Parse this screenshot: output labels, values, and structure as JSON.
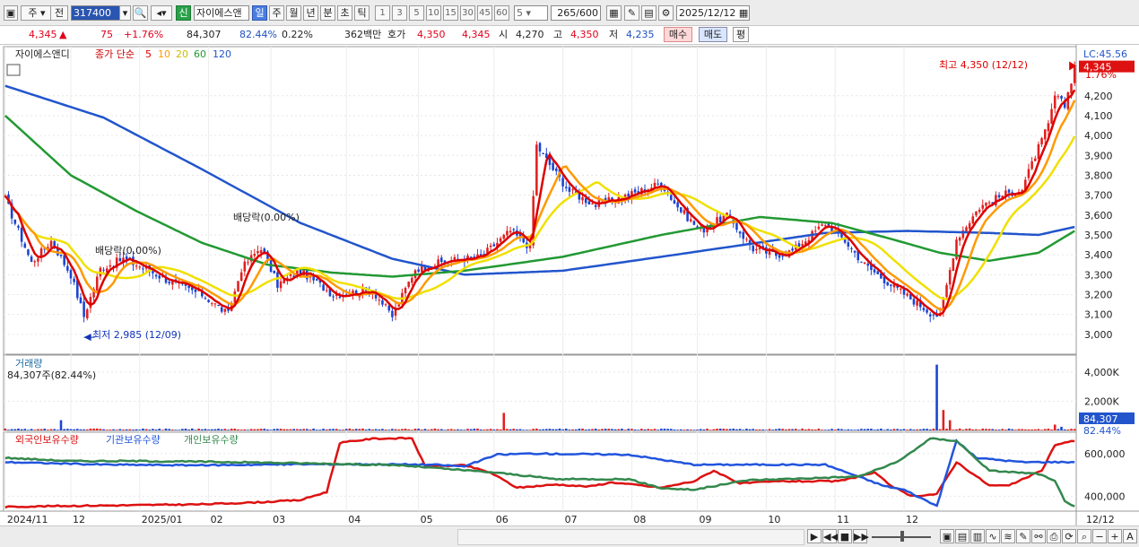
{
  "toolbar": {
    "period_week": "주",
    "prev_label": "전",
    "code": "317400",
    "new_badge": "신",
    "stock_name": "자이에스앤",
    "period_day": "일",
    "period_week2": "주",
    "period_month": "월",
    "period_year": "년",
    "period_minute": "분",
    "period_second": "초",
    "period_tick": "틱",
    "minute_options": [
      "1",
      "3",
      "5",
      "10",
      "15",
      "30",
      "45",
      "60"
    ],
    "minute_value": "5",
    "count_current": "265",
    "count_total": "/600",
    "date": "2025/12/12"
  },
  "quote": {
    "price": "4,345",
    "arrow": "▲",
    "change": "75",
    "change_pct": "+1.76%",
    "volume": "84,307",
    "volume_ratio": "82.44%",
    "turnover": "0.22%",
    "trade_value": "362백만",
    "ask_label": "호가",
    "ask_price": "4,350",
    "bid_price": "4,345",
    "open_label": "시",
    "open": "4,270",
    "high_label": "고",
    "high": "4,350",
    "low_label": "저",
    "low": "4,235",
    "buy_label": "매수",
    "sell_label": "매도",
    "eval_label": "평"
  },
  "chart_data": [
    {
      "type": "candlestick",
      "title": "자이에스앤디",
      "legend": [
        {
          "name": "종가 단순",
          "color": "#cc0000"
        },
        {
          "name": "5",
          "color": "#dd0000"
        },
        {
          "name": "10",
          "color": "#ff9900"
        },
        {
          "name": "20",
          "color": "#eedd00"
        },
        {
          "name": "60",
          "color": "#229933"
        },
        {
          "name": "120",
          "color": "#2255cc"
        }
      ],
      "ylim": [
        2900,
        4420
      ],
      "yticks": [
        "4,200",
        "4,100",
        "4,000",
        "3,900",
        "3,800",
        "3,700",
        "3,600",
        "3,500",
        "3,400",
        "3,300",
        "3,200",
        "3,100",
        "3,000"
      ],
      "ytick_values": [
        4200,
        4100,
        4000,
        3900,
        3800,
        3700,
        3600,
        3500,
        3400,
        3300,
        3200,
        3100,
        3000
      ],
      "x_labels": [
        "2024/11",
        "12",
        "2025/01",
        "02",
        "03",
        "04",
        "05",
        "06",
        "07",
        "08",
        "09",
        "10",
        "11",
        "12"
      ],
      "x_label_right": "12/12",
      "close_anchors": [
        [
          0,
          3680
        ],
        [
          8,
          3360
        ],
        [
          14,
          3470
        ],
        [
          20,
          3300
        ],
        [
          24,
          3090
        ],
        [
          29,
          3330
        ],
        [
          36,
          3380
        ],
        [
          44,
          3320
        ],
        [
          52,
          3250
        ],
        [
          60,
          3200
        ],
        [
          68,
          3100
        ],
        [
          72,
          3330
        ],
        [
          78,
          3440
        ],
        [
          83,
          3250
        ],
        [
          90,
          3320
        ],
        [
          100,
          3200
        ],
        [
          112,
          3220
        ],
        [
          118,
          3090
        ],
        [
          125,
          3330
        ],
        [
          135,
          3370
        ],
        [
          145,
          3390
        ],
        [
          154,
          3520
        ],
        [
          160,
          3440
        ],
        [
          162,
          3950
        ],
        [
          167,
          3830
        ],
        [
          172,
          3720
        ],
        [
          180,
          3650
        ],
        [
          190,
          3700
        ],
        [
          200,
          3760
        ],
        [
          205,
          3640
        ],
        [
          212,
          3520
        ],
        [
          220,
          3600
        ],
        [
          228,
          3430
        ],
        [
          235,
          3400
        ],
        [
          240,
          3420
        ],
        [
          250,
          3560
        ],
        [
          256,
          3470
        ],
        [
          262,
          3350
        ],
        [
          270,
          3250
        ],
        [
          276,
          3180
        ],
        [
          282,
          3110
        ],
        [
          285,
          3090
        ],
        [
          290,
          3480
        ],
        [
          297,
          3640
        ],
        [
          304,
          3700
        ],
        [
          310,
          3730
        ],
        [
          314,
          3900
        ],
        [
          318,
          4050
        ],
        [
          320,
          4200
        ],
        [
          323,
          4150
        ],
        [
          326,
          4345
        ]
      ],
      "ma_anchors": {
        "ma60": [
          [
            0,
            4100
          ],
          [
            20,
            3800
          ],
          [
            40,
            3620
          ],
          [
            60,
            3460
          ],
          [
            80,
            3350
          ],
          [
            100,
            3310
          ],
          [
            118,
            3290
          ],
          [
            140,
            3320
          ],
          [
            170,
            3390
          ],
          [
            200,
            3500
          ],
          [
            230,
            3590
          ],
          [
            252,
            3560
          ],
          [
            270,
            3480
          ],
          [
            285,
            3410
          ],
          [
            300,
            3370
          ],
          [
            315,
            3410
          ],
          [
            326,
            3520
          ]
        ],
        "ma120": [
          [
            0,
            4250
          ],
          [
            30,
            4090
          ],
          [
            60,
            3830
          ],
          [
            90,
            3560
          ],
          [
            118,
            3380
          ],
          [
            140,
            3300
          ],
          [
            170,
            3320
          ],
          [
            200,
            3390
          ],
          [
            225,
            3450
          ],
          [
            250,
            3510
          ],
          [
            275,
            3520
          ],
          [
            300,
            3510
          ],
          [
            315,
            3500
          ],
          [
            326,
            3540
          ]
        ]
      },
      "annotations": [
        {
          "text": "최고 4,350 (12/12)",
          "price": 4350
        },
        {
          "text": "최저 2,985 (12/09)",
          "price": 2985
        },
        {
          "text": "배당락(0.00%)",
          "price": 3590
        },
        {
          "text": "배당락(0.00%)",
          "price": 3430
        }
      ],
      "last_price_label": "4,345",
      "last_pct_label": "1.76%",
      "last_lc_label": "LC:45.56"
    },
    {
      "type": "bar",
      "title": "거래량",
      "value_label": "84,307주(82.44%)",
      "yticks": [
        "4,000K",
        "2,000K"
      ],
      "ytick_values": [
        4000,
        2000
      ],
      "ylim": [
        0,
        4600
      ],
      "last_label": "84,307",
      "ratio_label": "82.44%",
      "spikes": [
        [
          17,
          700
        ],
        [
          152,
          1200
        ],
        [
          284,
          4500
        ],
        [
          286,
          1400
        ],
        [
          288,
          700
        ],
        [
          320,
          400
        ],
        [
          322,
          250
        ]
      ]
    },
    {
      "type": "line",
      "title": "보유수량",
      "series": [
        {
          "name": "외국인보유수량",
          "color": "#dd1111",
          "anchors": [
            [
              0,
              350
            ],
            [
              20,
              355
            ],
            [
              40,
              358
            ],
            [
              60,
              362
            ],
            [
              78,
              372
            ],
            [
              90,
              382
            ],
            [
              98,
              420
            ],
            [
              102,
              650
            ],
            [
              112,
              670
            ],
            [
              124,
              672
            ],
            [
              128,
              540
            ],
            [
              140,
              545
            ],
            [
              148,
              510
            ],
            [
              156,
              440
            ],
            [
              168,
              455
            ],
            [
              178,
              445
            ],
            [
              185,
              465
            ],
            [
              200,
              440
            ],
            [
              210,
              470
            ],
            [
              216,
              520
            ],
            [
              224,
              460
            ],
            [
              236,
              470
            ],
            [
              254,
              470
            ],
            [
              265,
              510
            ],
            [
              270,
              450
            ],
            [
              276,
              400
            ],
            [
              284,
              410
            ],
            [
              290,
              560
            ],
            [
              300,
              450
            ],
            [
              306,
              450
            ],
            [
              316,
              520
            ],
            [
              320,
              640
            ],
            [
              326,
              660
            ]
          ]
        },
        {
          "name": "기관보유수량",
          "color": "#2255dd",
          "anchors": [
            [
              0,
              560
            ],
            [
              30,
              548
            ],
            [
              60,
              545
            ],
            [
              90,
              550
            ],
            [
              110,
              550
            ],
            [
              130,
              548
            ],
            [
              140,
              540
            ],
            [
              150,
              595
            ],
            [
              160,
              600
            ],
            [
              190,
              595
            ],
            [
              210,
              548
            ],
            [
              230,
              548
            ],
            [
              250,
              548
            ],
            [
              268,
              448
            ],
            [
              274,
              430
            ],
            [
              284,
              355
            ],
            [
              290,
              660
            ],
            [
              296,
              580
            ],
            [
              310,
              560
            ],
            [
              326,
              560
            ]
          ]
        },
        {
          "name": "개인보유수량",
          "color": "#33884d",
          "anchors": [
            [
              0,
              580
            ],
            [
              20,
              565
            ],
            [
              40,
              565
            ],
            [
              70,
              560
            ],
            [
              100,
              552
            ],
            [
              120,
              545
            ],
            [
              150,
              510
            ],
            [
              168,
              480
            ],
            [
              190,
              480
            ],
            [
              200,
              438
            ],
            [
              210,
              430
            ],
            [
              226,
              475
            ],
            [
              260,
              492
            ],
            [
              272,
              560
            ],
            [
              282,
              670
            ],
            [
              290,
              660
            ],
            [
              300,
              520
            ],
            [
              315,
              505
            ],
            [
              320,
              470
            ],
            [
              323,
              380
            ],
            [
              326,
              350
            ]
          ]
        }
      ],
      "yticks": [
        "600,000",
        "400,000"
      ],
      "ytick_values": [
        600,
        400
      ],
      "ylim": [
        330,
        700
      ]
    }
  ],
  "footer": {
    "nav_icons": [
      "play-right-icon",
      "rewind-icon",
      "stop-icon",
      "fast-forward-icon"
    ]
  }
}
